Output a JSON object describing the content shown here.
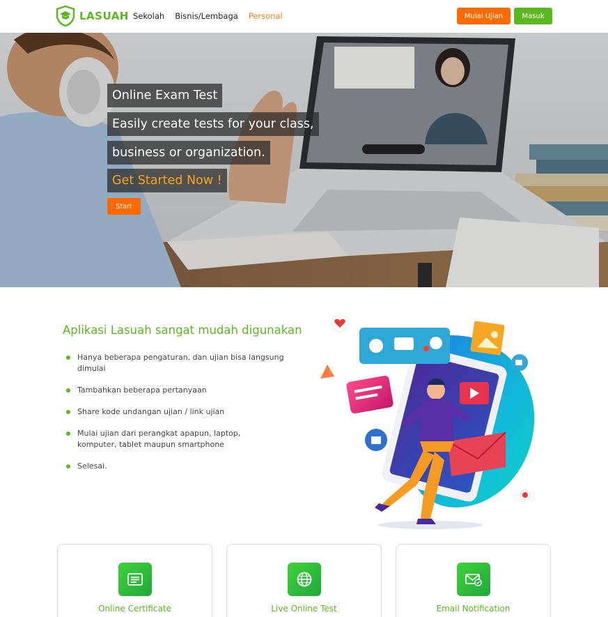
{
  "nav": {
    "brand": "LASUAH",
    "links": [
      {
        "label": "Sekolah",
        "active": false
      },
      {
        "label": "Bisnis/Lembaga",
        "active": false
      },
      {
        "label": "Personal",
        "active": true
      }
    ],
    "exam_button": "Mulai Ujian",
    "login_button": "Masuk"
  },
  "hero": {
    "line1": "Online Exam Test",
    "line2": "Easily create tests for your class,",
    "line3": "business or organization.",
    "line4": "Get Started Now !",
    "start_button": "Start"
  },
  "features": {
    "title": "Aplikasi Lasuah sangat mudah digunakan",
    "items": [
      "Hanya beberapa pengaturan, dan ujian bisa langsung dimulai",
      "Tambahkan beberapa pertanyaan",
      "Share kode undangan ujian / link ujian",
      "Mulai ujian dari perangkat apapun, laptop, komputer, tablet maupun smartphone",
      "Selesai."
    ]
  },
  "cards": [
    {
      "label": "Online Certificate",
      "icon": "certificate-icon"
    },
    {
      "label": "Live Online Test",
      "icon": "globe-icon"
    },
    {
      "label": "Email Notification",
      "icon": "email-icon"
    }
  ],
  "colors": {
    "brand_green": "#5cb81f",
    "accent_orange": "#fd6a02",
    "hero_orange_text": "#f7a41d"
  }
}
